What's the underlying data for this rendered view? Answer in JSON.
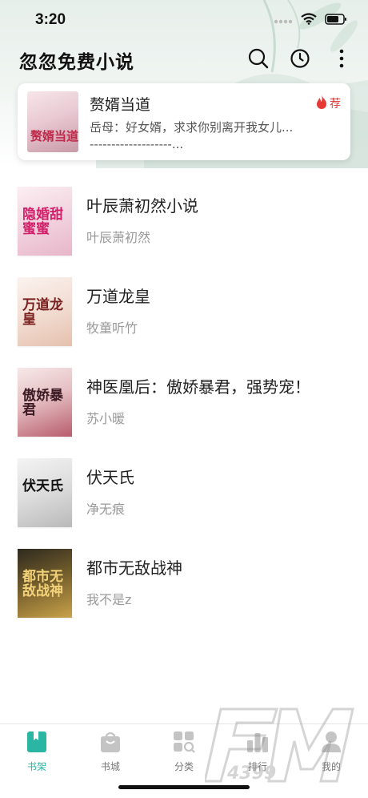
{
  "status_bar": {
    "time": "3:20"
  },
  "header": {
    "title": "忽忽免费小说"
  },
  "recommend": {
    "title": "赘婿当道",
    "badge": "荐",
    "desc_line1": "岳母：好女婿，求求你别离开我女儿...",
    "desc_line2": "-------------------...",
    "cover_text": "赘婿当道"
  },
  "books": [
    {
      "title": "叶辰萧初然小说",
      "author": "叶辰萧初然",
      "cover_text": "隐婚甜蜜蜜"
    },
    {
      "title": "万道龙皇",
      "author": "牧童听竹",
      "cover_text": "万道龙皇"
    },
    {
      "title": "神医凰后：傲娇暴君，强势宠！",
      "author": "苏小暖",
      "cover_text": "傲娇暴君"
    },
    {
      "title": "伏天氏",
      "author": "净无痕",
      "cover_text": "伏天氏"
    },
    {
      "title": "都市无敌战神",
      "author": "我不是z",
      "cover_text": "都市无敌战神"
    }
  ],
  "tabs": [
    {
      "label": "书架",
      "icon": "bookshelf-icon",
      "active": true
    },
    {
      "label": "书城",
      "icon": "store-bag-icon",
      "active": false
    },
    {
      "label": "分类",
      "icon": "category-grid-icon",
      "active": false
    },
    {
      "label": "排行",
      "icon": "ranking-icon",
      "active": false
    },
    {
      "label": "我的",
      "icon": "profile-icon",
      "active": false
    }
  ],
  "colors": {
    "accent": "#2bb5a3",
    "hot": "#e53935"
  }
}
